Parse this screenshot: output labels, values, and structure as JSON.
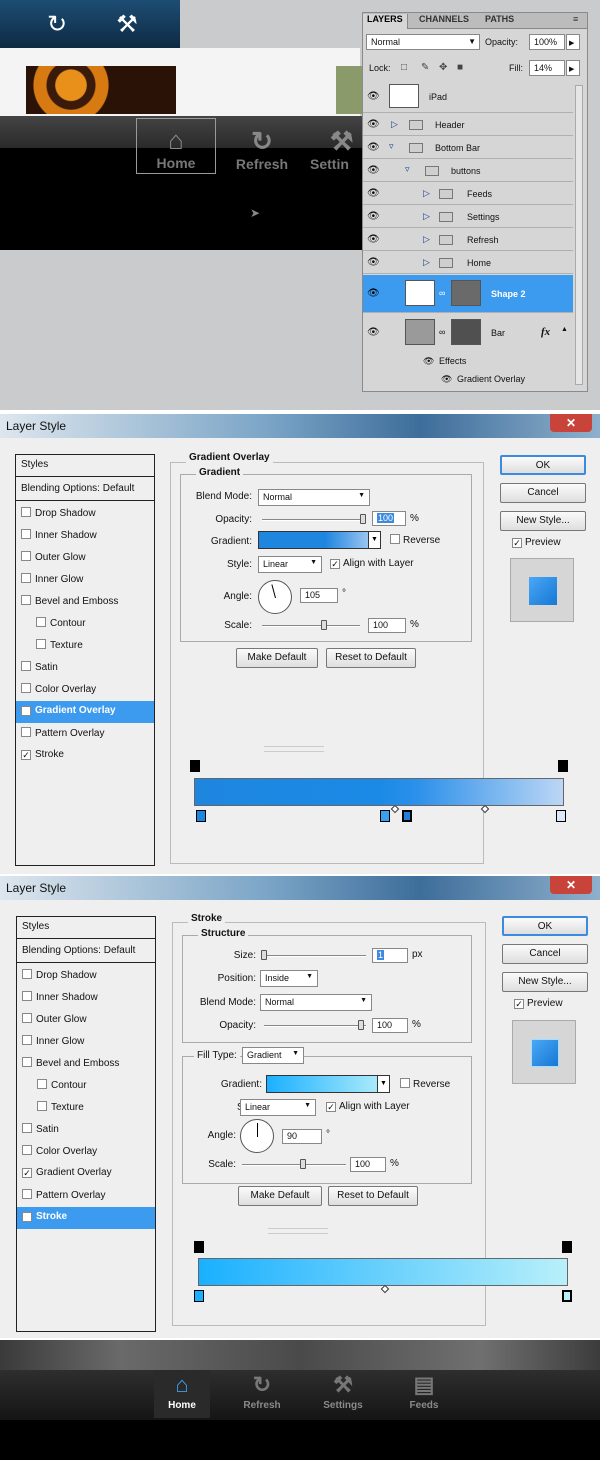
{
  "top": {
    "tab_icons": [
      "refresh-icon",
      "wrench-icon"
    ],
    "toolbar_buttons": [
      "Home",
      "Refresh",
      "Settin"
    ]
  },
  "layers_panel": {
    "tabs": [
      "LAYERS",
      "CHANNELS",
      "PATHS"
    ],
    "blend_mode": "Normal",
    "opacity_label": "Opacity:",
    "opacity_value": "100%",
    "lock_label": "Lock:",
    "fill_label": "Fill:",
    "fill_value": "14%",
    "layers": [
      {
        "name": "iPad",
        "type": "smart"
      },
      {
        "name": "Header",
        "type": "folder"
      },
      {
        "name": "Bottom Bar",
        "type": "folder"
      },
      {
        "name": "buttons",
        "type": "folder"
      },
      {
        "name": "Feeds",
        "type": "folder"
      },
      {
        "name": "Settings",
        "type": "folder"
      },
      {
        "name": "Refresh",
        "type": "folder"
      },
      {
        "name": "Home",
        "type": "folder"
      },
      {
        "name": "Shape 2",
        "type": "shape",
        "selected": true
      },
      {
        "name": "Bar",
        "type": "shape"
      },
      {
        "name": "Effects",
        "type": "effects"
      },
      {
        "name": "Gradient Overlay",
        "type": "effect"
      }
    ],
    "fx_label": "fx"
  },
  "dialog1": {
    "title": "Layer Style",
    "sidebar": [
      {
        "label": "Styles",
        "checked": null
      },
      {
        "label": "Blending Options: Default",
        "checked": null
      },
      {
        "label": "Drop Shadow",
        "checked": false
      },
      {
        "label": "Inner Shadow",
        "checked": false
      },
      {
        "label": "Outer Glow",
        "checked": false
      },
      {
        "label": "Inner Glow",
        "checked": false
      },
      {
        "label": "Bevel and Emboss",
        "checked": false
      },
      {
        "label": "Contour",
        "checked": false
      },
      {
        "label": "Texture",
        "checked": false
      },
      {
        "label": "Satin",
        "checked": false
      },
      {
        "label": "Color Overlay",
        "checked": false
      },
      {
        "label": "Gradient Overlay",
        "checked": true
      },
      {
        "label": "Pattern Overlay",
        "checked": false
      },
      {
        "label": "Stroke",
        "checked": true
      }
    ],
    "section_title": "Gradient Overlay",
    "group_title": "Gradient",
    "blend_mode_label": "Blend Mode:",
    "blend_mode": "Normal",
    "opacity_label": "Opacity:",
    "opacity": "100",
    "pct": "%",
    "gradient_label": "Gradient:",
    "reverse_label": "Reverse",
    "style_label": "Style:",
    "style": "Linear",
    "align_label": "Align with Layer",
    "angle_label": "Angle:",
    "angle": "105",
    "deg": "°",
    "scale_label": "Scale:",
    "scale": "100",
    "make_default": "Make Default",
    "reset_default": "Reset to Default",
    "ok": "OK",
    "cancel": "Cancel",
    "new_style": "New Style...",
    "preview": "Preview",
    "opacity_fraction": 1.0,
    "scale_fraction": 0.6
  },
  "dialog2": {
    "title": "Layer Style",
    "sidebar": [
      {
        "label": "Styles",
        "checked": null
      },
      {
        "label": "Blending Options: Default",
        "checked": null
      },
      {
        "label": "Drop Shadow",
        "checked": false
      },
      {
        "label": "Inner Shadow",
        "checked": false
      },
      {
        "label": "Outer Glow",
        "checked": false
      },
      {
        "label": "Inner Glow",
        "checked": false
      },
      {
        "label": "Bevel and Emboss",
        "checked": false
      },
      {
        "label": "Contour",
        "checked": false
      },
      {
        "label": "Texture",
        "checked": false
      },
      {
        "label": "Satin",
        "checked": false
      },
      {
        "label": "Color Overlay",
        "checked": false
      },
      {
        "label": "Gradient Overlay",
        "checked": true
      },
      {
        "label": "Pattern Overlay",
        "checked": false
      },
      {
        "label": "Stroke",
        "checked": true
      }
    ],
    "section_title": "Stroke",
    "group_title": "Structure",
    "size_label": "Size:",
    "size": "1",
    "px": "px",
    "position_label": "Position:",
    "position": "Inside",
    "blend_mode_label": "Blend Mode:",
    "blend_mode": "Normal",
    "opacity_label": "Opacity:",
    "opacity": "100",
    "pct": "%",
    "fill_type_label": "Fill Type:",
    "fill_type": "Gradient",
    "gradient_label": "Gradient:",
    "reverse_label": "Reverse",
    "style_label": "Style:",
    "style": "Linear",
    "align_label": "Align with Layer",
    "angle_label": "Angle:",
    "angle": "90",
    "deg": "°",
    "scale_label": "Scale:",
    "scale": "100",
    "make_default": "Make Default",
    "reset_default": "Reset to Default",
    "ok": "OK",
    "cancel": "Cancel",
    "new_style": "New Style...",
    "preview": "Preview"
  },
  "bottom_bar": {
    "buttons": [
      {
        "label": "Home",
        "icon": "home-icon",
        "selected": true
      },
      {
        "label": "Refresh",
        "icon": "refresh-icon",
        "selected": false
      },
      {
        "label": "Settings",
        "icon": "wrench-icon",
        "selected": false
      },
      {
        "label": "Feeds",
        "icon": "rss-icon",
        "selected": false
      }
    ]
  },
  "colors": {
    "selection_blue": "#3d9bef",
    "grad1_start": "#1f86e0",
    "grad1_end": "#bcd6f5",
    "grad2_start": "#1ab0ff",
    "grad2_end": "#b8f0fa",
    "home_active": "#3aa0ee"
  }
}
